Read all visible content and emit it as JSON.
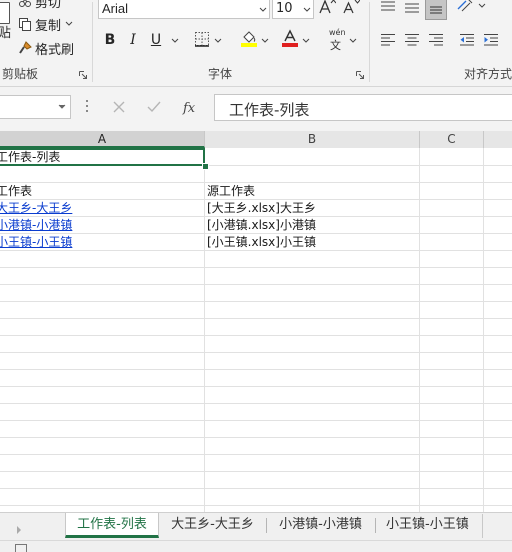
{
  "clipboard": {
    "cut_label": "剪切",
    "copy_label": "复制",
    "format_painter_label": "格式刷",
    "paste_partial": "贴",
    "group_label": "剪贴板"
  },
  "font": {
    "family": "Arial",
    "size": "10",
    "group_label": "字体",
    "bold": "B",
    "italic": "I",
    "underline": "U",
    "wen_top": "wén",
    "wen_bottom": "文"
  },
  "alignment": {
    "group_label": "对齐方式"
  },
  "formula_bar": {
    "fx": "fx",
    "content": "工作表-列表"
  },
  "columns": [
    "A",
    "B",
    "C"
  ],
  "cells": {
    "a1": "工作表-列表",
    "a3": "工作表",
    "b3": "源工作表",
    "rows": [
      {
        "a": "大王乡-大王乡",
        "b": "[大王乡.xlsx]大王乡"
      },
      {
        "a": "小港镇-小港镇",
        "b": "[小港镇.xlsx]小港镇"
      },
      {
        "a": "小王镇-小王镇",
        "b": "[小王镇.xlsx]小王镇"
      }
    ]
  },
  "sheet_tabs": [
    "工作表-列表",
    "大王乡-大王乡",
    "小港镇-小港镇",
    "小王镇-小王镇"
  ],
  "colors": {
    "accent_green": "#217346",
    "link_blue": "#0a3ccf",
    "highlight_yellow": "#ffff00",
    "font_red": "#e02020"
  }
}
